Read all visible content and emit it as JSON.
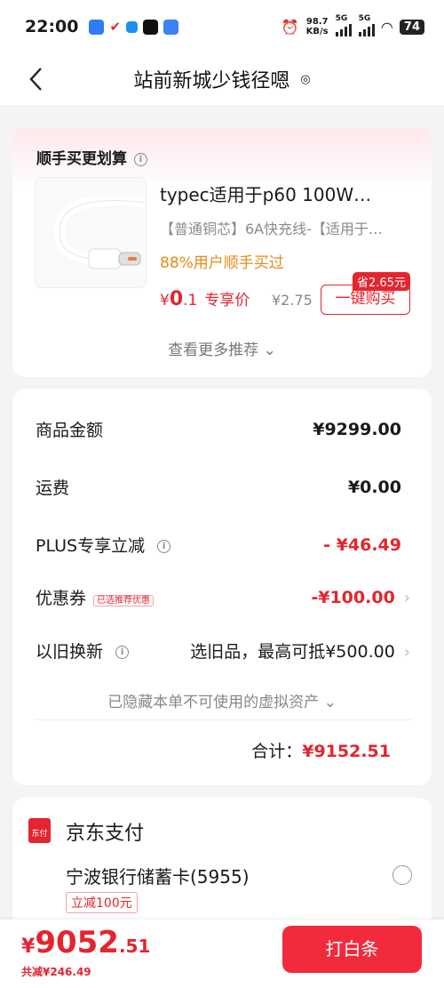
{
  "status_bar": {
    "time": "22:00",
    "net_speed": "98.7",
    "net_unit": "KB/s",
    "sig1": "5G",
    "sig2": "5G",
    "battery": "74"
  },
  "nav": {
    "title": "站前新城少钱径嗯",
    "back_icon": "chevron-left-icon",
    "location_icon": "location-pin-icon"
  },
  "recommend": {
    "heading": "顺手买更划算",
    "product_title": "typec适用于p60 100W…",
    "product_sub": "【普通铜芯】6A快充线-【适用于…",
    "rate": "88%用户顺手买过",
    "price_yen": "¥",
    "price_int": "0",
    "price_dec": ".1",
    "price_tag": "专享价",
    "orig_price": "¥2.75",
    "save_badge": "省2.65元",
    "buy_label": "一键购买",
    "more": "查看更多推荐"
  },
  "summary": {
    "goods_label": "商品金额",
    "goods_value": "¥9299.00",
    "ship_label": "运费",
    "ship_value": "¥0.00",
    "plus_label": "PLUS专享立减",
    "plus_value": "- ¥46.49",
    "coupon_label": "优惠券",
    "coupon_badge": "已选推荐优惠",
    "coupon_value": "-¥100.00",
    "tradein_label": "以旧换新",
    "tradein_value": "选旧品，最高可抵¥500.00",
    "hidden_note": "已隐藏本单不可使用的虚拟资产",
    "total_label": "合计：",
    "total_value": "¥9152.51"
  },
  "payment": {
    "icon_text": "东付",
    "title": "京东支付",
    "bank": "宁波银行储蓄卡(5955)",
    "promo": "立减100元"
  },
  "bottom": {
    "yen": "¥",
    "int": "9052",
    "dec": ".51",
    "saved": "共减¥246.49",
    "pay_label": "打白条"
  },
  "colors": {
    "accent": "#e4252f",
    "orange": "#e58b18"
  }
}
